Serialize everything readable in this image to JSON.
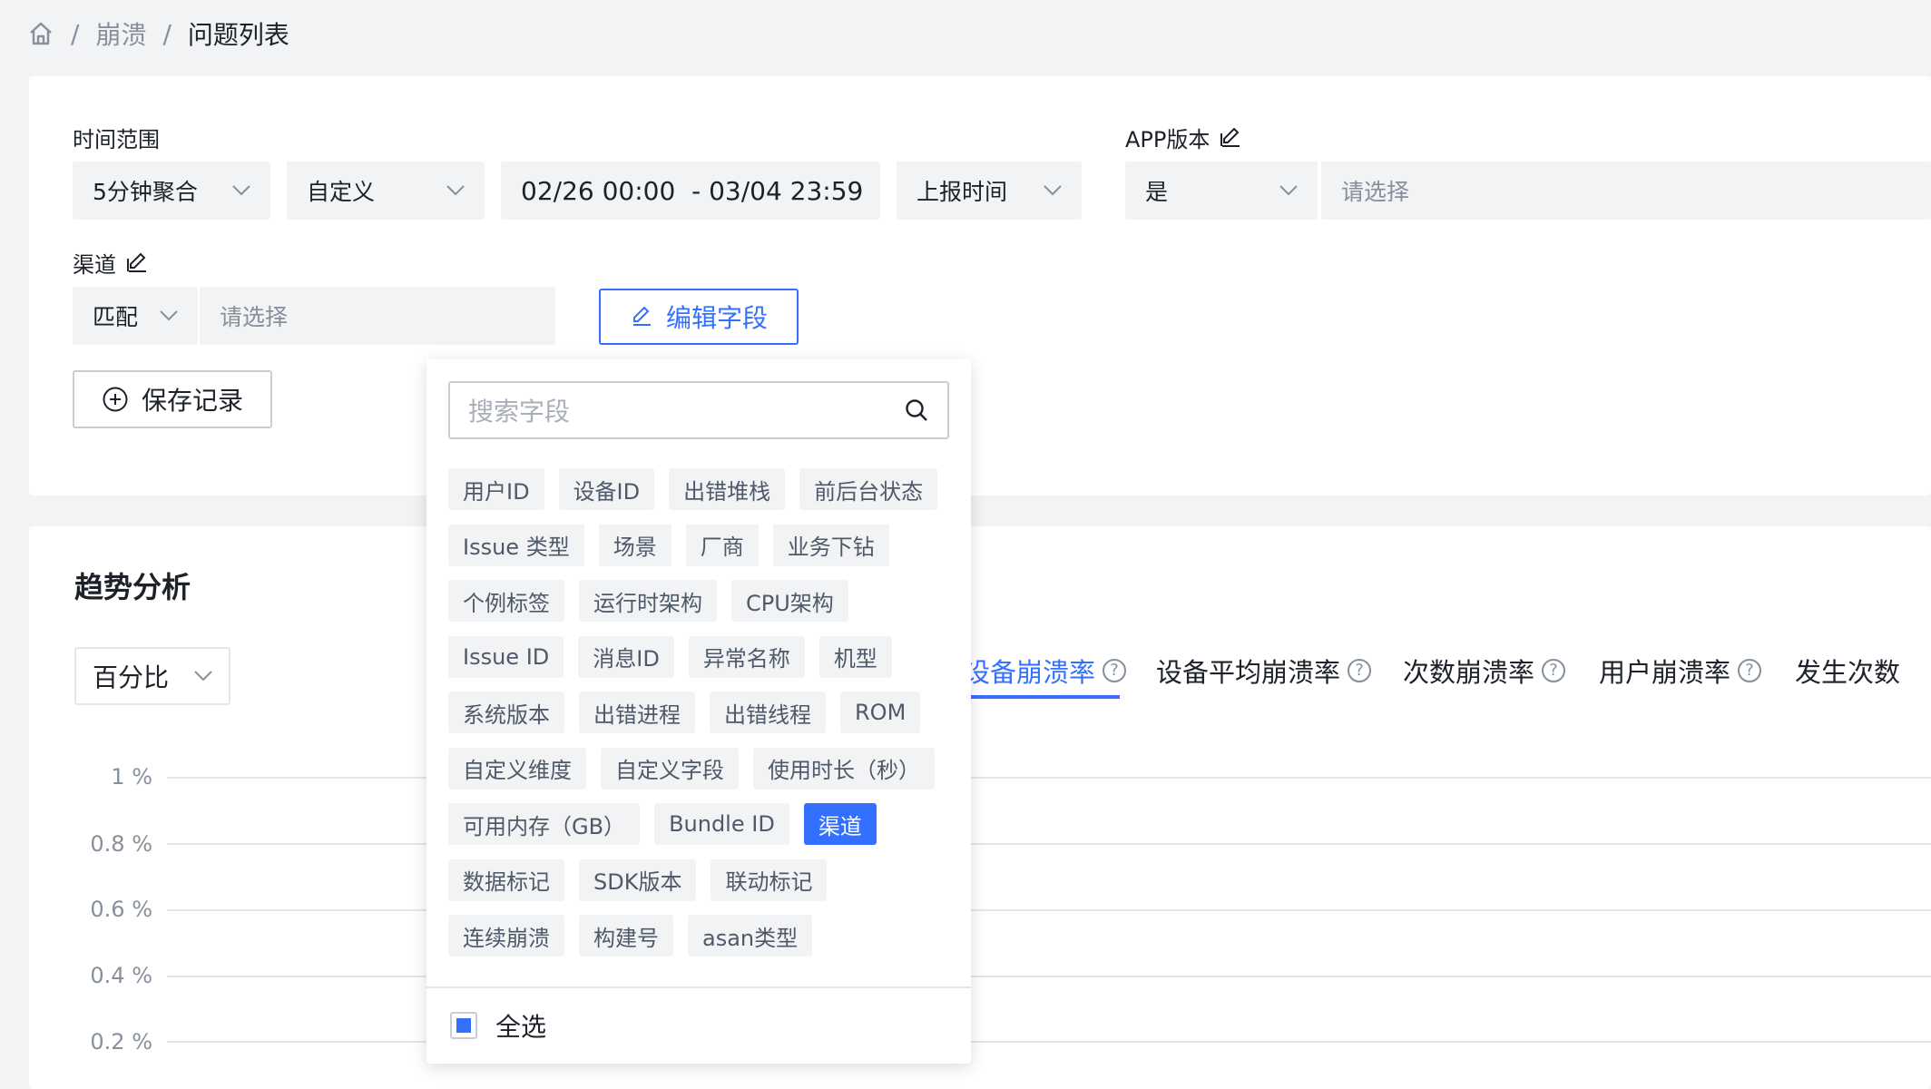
{
  "breadcrumb": {
    "items": [
      "崩溃",
      "问题列表"
    ],
    "separator": "/"
  },
  "filters": {
    "time_range": {
      "label": "时间范围",
      "aggregation": "5分钟聚合",
      "mode": "自定义",
      "date_range": "02/26 00:00  - 03/04 23:59",
      "time_type": "上报时间"
    },
    "app_version": {
      "label": "APP版本",
      "operator": "是",
      "placeholder": "请选择"
    },
    "channel": {
      "label": "渠道",
      "operator": "匹配",
      "placeholder": "请选择"
    },
    "edit_fields_label": "编辑字段",
    "save_record_label": "保存记录"
  },
  "trend": {
    "title": "趋势分析",
    "mode": "百分比",
    "tabs": [
      {
        "label": "设备崩溃率",
        "active": true
      },
      {
        "label": "设备平均崩溃率",
        "active": false
      },
      {
        "label": "次数崩溃率",
        "active": false
      },
      {
        "label": "用户崩溃率",
        "active": false
      },
      {
        "label": "发生次数",
        "active": false
      }
    ],
    "y_ticks": [
      "1 %",
      "0.8 %",
      "0.6 %",
      "0.4 %",
      "0.2 %"
    ]
  },
  "field_panel": {
    "search_placeholder": "搜索字段",
    "rows": [
      [
        "用户ID",
        "设备ID",
        "出错堆栈",
        "前后台状态"
      ],
      [
        "Issue 类型",
        "场景",
        "厂商",
        "业务下钻"
      ],
      [
        "个例标签",
        "运行时架构",
        "CPU架构"
      ],
      [
        "Issue ID",
        "消息ID",
        "异常名称",
        "机型"
      ],
      [
        "系统版本",
        "出错进程",
        "出错线程",
        "ROM"
      ],
      [
        "自定义维度",
        "自定义字段",
        "使用时长（秒）"
      ],
      [
        "可用内存（GB）",
        "Bundle ID",
        "渠道"
      ],
      [
        "数据标记",
        "SDK版本",
        "联动标记"
      ],
      [
        "连续崩溃",
        "构建号",
        "asan类型"
      ]
    ],
    "selected_field": "渠道",
    "select_all_label": "全选"
  },
  "colors": {
    "primary": "#3370ff",
    "background": "#f2f3f5",
    "text": "#1d2129",
    "muted": "#86909c"
  }
}
